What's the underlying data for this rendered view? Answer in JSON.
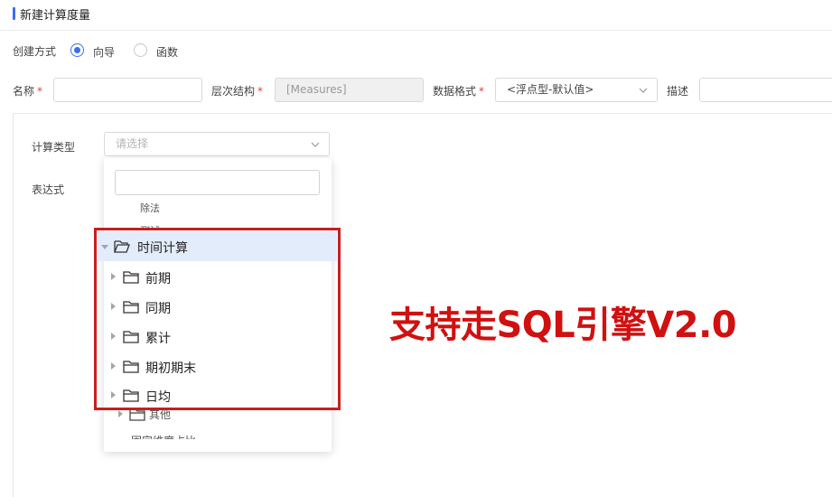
{
  "header": {
    "title": "新建计算度量"
  },
  "form": {
    "create_method": {
      "label": "创建方式",
      "options": [
        {
          "label": "向导",
          "checked": true
        },
        {
          "label": "函数",
          "checked": false
        }
      ]
    },
    "name": {
      "label": "名称",
      "value": ""
    },
    "hierarchy": {
      "label": "层次结构",
      "value": "[Measures]"
    },
    "data_format": {
      "label": "数据格式",
      "value": "<浮点型-默认值>"
    },
    "description": {
      "label": "描述",
      "value": ""
    }
  },
  "panel": {
    "calc_type": {
      "label": "计算类型",
      "placeholder": "请选择"
    },
    "expression": {
      "label": "表达式"
    }
  },
  "dropdown": {
    "search_value": "",
    "faded_top": [
      "除法",
      "测试"
    ],
    "tree": {
      "root": {
        "label": "时间计算",
        "expanded": true
      },
      "children": [
        {
          "label": "前期"
        },
        {
          "label": "同期"
        },
        {
          "label": "累计"
        },
        {
          "label": "期初期末"
        },
        {
          "label": "日均"
        }
      ]
    },
    "faded_bottom": [
      "其他",
      "固定维度占比"
    ]
  },
  "promo_text": "支持走SQL引擎V2.0",
  "colors": {
    "accent": "#3a6ff2",
    "highlight_border": "#c81e1e",
    "promo": "#d11010",
    "selected_row": "#e3ecfb"
  }
}
